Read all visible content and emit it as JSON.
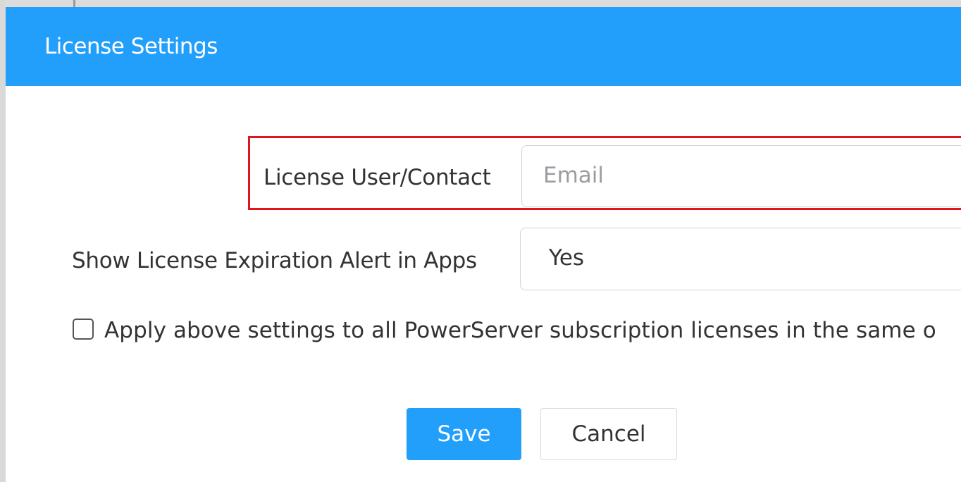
{
  "dialog": {
    "title": "License Settings"
  },
  "form": {
    "license_user": {
      "label": "License User/Contact",
      "placeholder": "Email",
      "value": ""
    },
    "expiration_alert": {
      "label": "Show License Expiration Alert in Apps",
      "selected": "Yes"
    },
    "apply_all": {
      "label": "Apply above settings to all PowerServer subscription licenses in the same o",
      "checked": false
    }
  },
  "actions": {
    "save_label": "Save",
    "cancel_label": "Cancel"
  },
  "colors": {
    "header": "#219ffb",
    "highlight": "#e0161c",
    "primary_button": "#219ffb"
  }
}
